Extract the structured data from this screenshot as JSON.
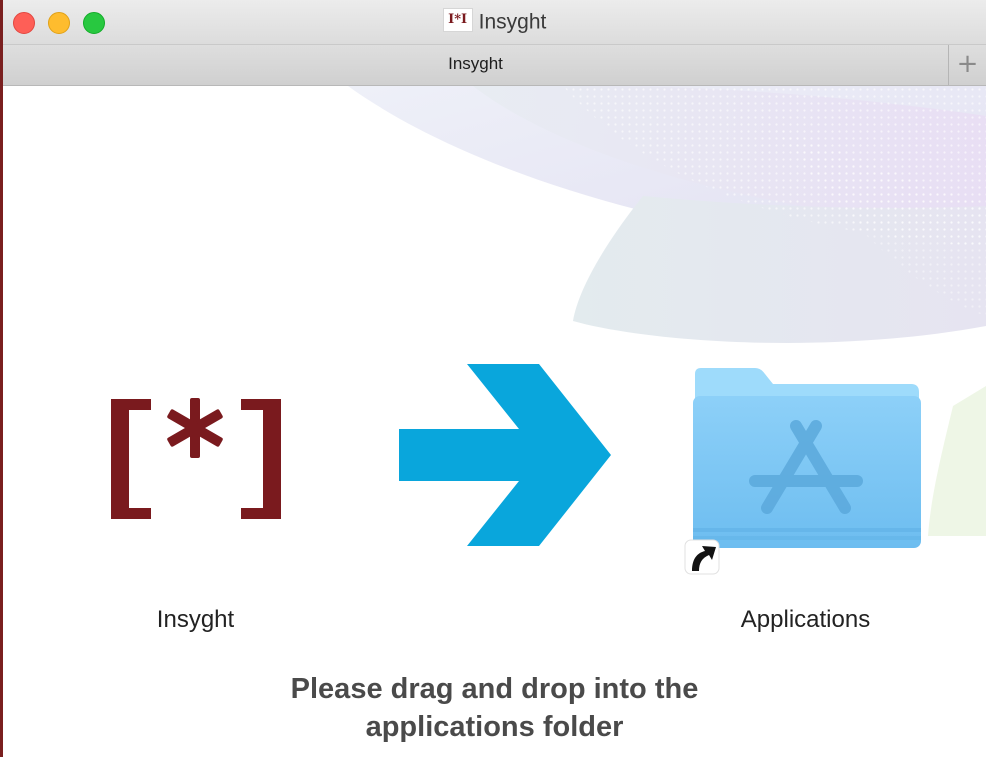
{
  "window": {
    "title": "Insyght",
    "title_icon_text": "I*I",
    "tab_label": "Insyght",
    "new_tab_symbol": "+"
  },
  "app_item": {
    "label": "Insyght",
    "logo_text": "[*]",
    "logo_color": "#7a1a1e"
  },
  "target_item": {
    "label": "Applications",
    "folder_color": "#7cc6f4"
  },
  "arrow": {
    "color": "#09a6dc"
  },
  "instructions": {
    "line1": "Please drag and drop into the",
    "line2": "applications folder"
  },
  "icons": [
    "window-close-icon",
    "window-minimize-icon",
    "window-zoom-icon",
    "plus-icon",
    "arrow-right-icon",
    "applications-folder-icon",
    "alias-arrow-icon"
  ]
}
